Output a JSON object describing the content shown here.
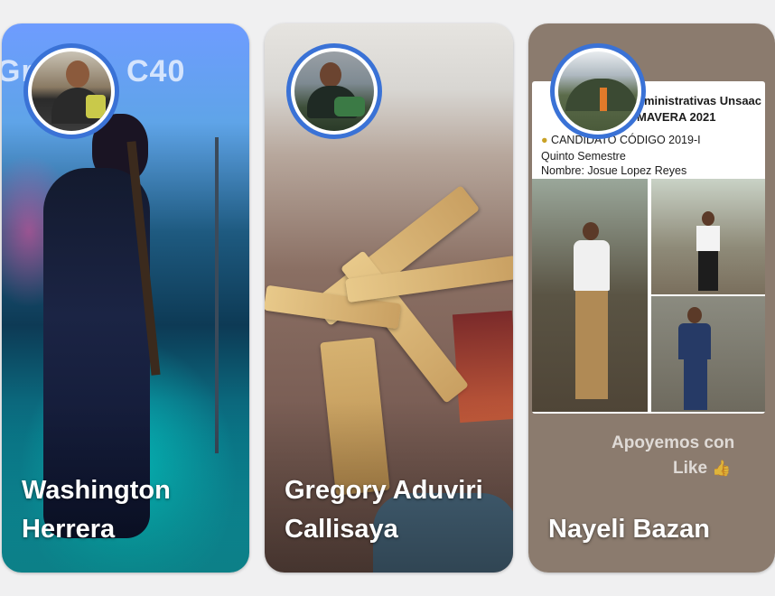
{
  "stories": [
    {
      "name_line1": "Washington",
      "name_line2": "Herrera",
      "background_text_left": "Gra",
      "background_text_right": "C40"
    },
    {
      "name_line1": "Gregory Aduviri",
      "name_line2": "Callisaya"
    },
    {
      "name_line1": "Nayeli Bazan",
      "post": {
        "header_line1": "dministrativas Unsaac",
        "header_line2": "MAVERA 2021",
        "candidate_line": "CANDIDATO CÓDIGO 2019-I",
        "semester_line": "Quinto Semestre",
        "name_line": "Nombre: Josue Lopez Reyes"
      },
      "caption_line1": "Apoyemos con",
      "caption_line2": "Like",
      "caption_emoji": "👍"
    }
  ],
  "colors": {
    "avatar_ring": "#3a72d6",
    "page_background": "#f0f0f1"
  },
  "icons": [
    "thumbs-up-icon"
  ]
}
